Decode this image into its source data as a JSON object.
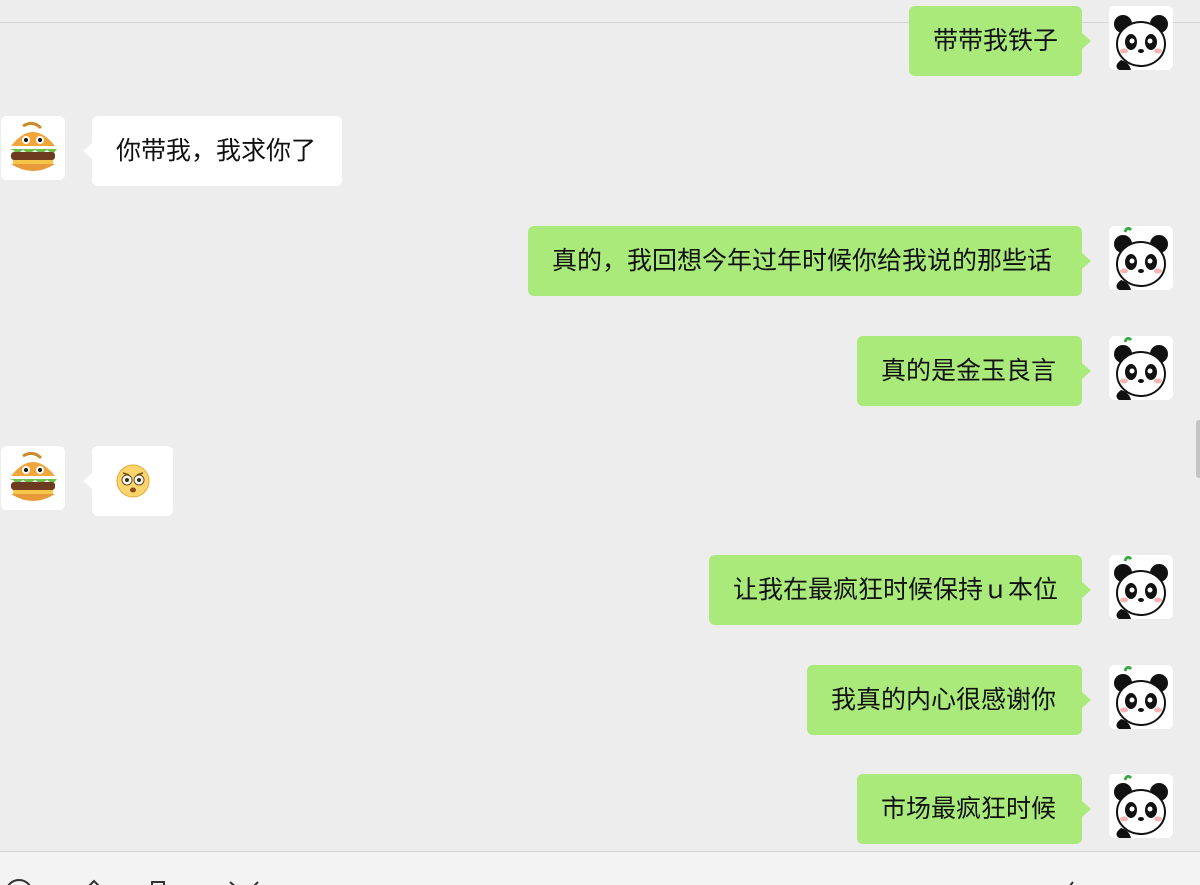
{
  "colors": {
    "background": "#ededed",
    "outgoing_bubble": "#a9ea7a",
    "incoming_bubble": "#ffffff"
  },
  "contact_avatar": "burger-avatar",
  "self_avatar": "panda-avatar",
  "messages": [
    {
      "direction": "out",
      "text": "带带我铁子"
    },
    {
      "direction": "in",
      "text": "你带我，我求你了"
    },
    {
      "direction": "out",
      "text": "真的，我回想今年过年时候你给我说的那些话"
    },
    {
      "direction": "out",
      "text": "真的是金玉良言"
    },
    {
      "direction": "in",
      "type": "emoji",
      "icon": "flushed-face-emoji"
    },
    {
      "direction": "out",
      "text": "让我在最疯狂时候保持ｕ本位"
    },
    {
      "direction": "out",
      "text": "我真的内心很感谢你"
    },
    {
      "direction": "out",
      "text": "市场最疯狂时候"
    }
  ],
  "toolbar": {
    "icons": [
      "emoji-icon",
      "favorites-icon",
      "file-icon",
      "scissors-icon",
      "chat-history-icon"
    ]
  }
}
